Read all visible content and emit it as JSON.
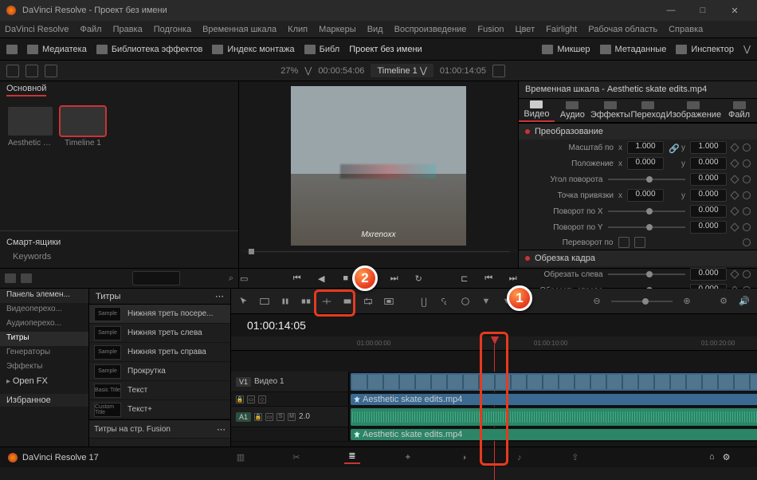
{
  "window": {
    "title": "DaVinci Resolve - Проект без имени",
    "min": "—",
    "max": "□",
    "close": "✕"
  },
  "menu": [
    "DaVinci Resolve",
    "Файл",
    "Правка",
    "Подгонка",
    "Временная шкала",
    "Клип",
    "Маркеры",
    "Вид",
    "Воспроизведение",
    "Fusion",
    "Цвет",
    "Fairlight",
    "Рабочая область",
    "Справка"
  ],
  "toolbar": {
    "media": "Медиатека",
    "fxlib": "Библиотека эффектов",
    "editindex": "Индекс монтажа",
    "soundlib": "Библ",
    "mixer": "Микшер",
    "metadata": "Метаданные",
    "inspector": "Инспектор"
  },
  "project_title": "Проект без имени",
  "topbar2": {
    "percent": "27%",
    "tc_viewer": "00:00:54:06",
    "timeline_tab": "Timeline 1",
    "tc_timeline": "01:00:14:05"
  },
  "mediapool": {
    "tab": "Основной",
    "thumbs": [
      {
        "label": "Aesthetic s..."
      },
      {
        "label": "Timeline 1"
      }
    ],
    "smartbins": "Смарт-ящики",
    "keywords": "Keywords"
  },
  "viewer": {
    "watermark": "Mxrenoxx"
  },
  "inspector": {
    "title": "Временная шкала - Aesthetic skate edits.mp4",
    "tabs": {
      "video": "Видео",
      "audio": "Аудио",
      "effects": "Эффекты",
      "transition": "Переход",
      "image": "Изображение",
      "file": "Файл"
    },
    "sect_transform": "Преобразование",
    "scale": "Масштаб по",
    "position": "Положение",
    "rotation": "Угол поворота",
    "anchor": "Точка привязки",
    "pitch": "Поворот по X",
    "yaw": "Поворот по Y",
    "flip": "Переворот по",
    "sect_crop": "Обрезка кадра",
    "crop_left": "Обрезать слева",
    "crop_right": "Обрезать справа",
    "vals": {
      "one": "1.000",
      "zero": "0.000"
    }
  },
  "effects_panel": {
    "header_collapsed": "Панель элемен...",
    "rows": [
      {
        "label": "Видеоперехо..."
      },
      {
        "label": "Аудиоперехо..."
      },
      {
        "label": "Титры",
        "sel": true
      },
      {
        "label": "Генераторы"
      },
      {
        "label": "Эффекты"
      }
    ],
    "openfx": "Open FX",
    "favorites": "Избранное"
  },
  "titles": {
    "header": "Титры",
    "items": [
      {
        "icon": "Sample",
        "label": "Нижняя треть посере...",
        "sel": true
      },
      {
        "icon": "Sample",
        "label": "Нижняя треть слева"
      },
      {
        "icon": "Sample",
        "label": "Нижняя треть справа"
      },
      {
        "icon": "Sample",
        "label": "Прокрутка"
      },
      {
        "icon": "Basic Title",
        "label": "Текст"
      },
      {
        "icon": "Custom Title",
        "label": "Текст+"
      }
    ],
    "fusion": "Титры на стр. Fusion"
  },
  "timeline": {
    "tc_big": "01:00:14:05",
    "ruler": [
      "01:00:00:00",
      "01:00:10:00",
      "01:00:20:00"
    ],
    "video_track": {
      "tag": "V1",
      "name": "Видео 1"
    },
    "audio_track": {
      "tag": "A1",
      "s": "S",
      "m": "M",
      "db": "2.0"
    },
    "clip_name": "Aesthetic skate edits.mp4"
  },
  "bottom": {
    "app": "DaVinci Resolve 17"
  },
  "annotations": {
    "b1": "1",
    "b2": "2"
  }
}
